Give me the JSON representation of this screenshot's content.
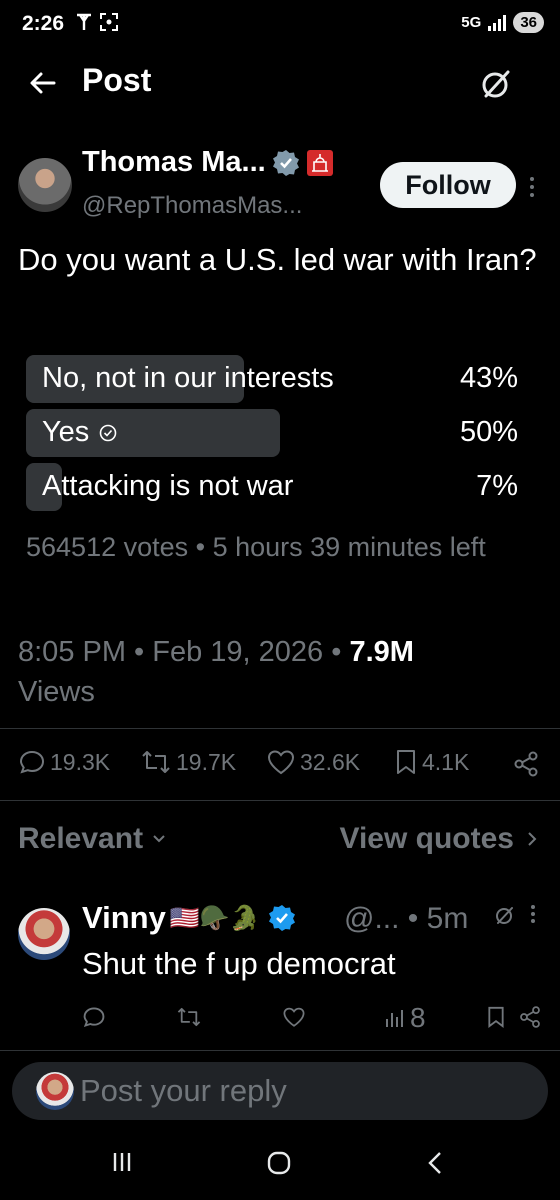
{
  "status_bar": {
    "time": "2:26",
    "network": "5G",
    "battery": "36"
  },
  "header": {
    "title": "Post"
  },
  "author": {
    "name": "Thomas Ma...",
    "handle": "@RepThomasMas...",
    "follow_label": "Follow"
  },
  "tweet": {
    "text": "Do you want a U.S. led war with Iran?"
  },
  "poll": {
    "options": [
      {
        "label": "No, not in our interests",
        "percent": "43%",
        "share": 0.43,
        "selected": false
      },
      {
        "label": "Yes",
        "percent": "50%",
        "share": 0.5,
        "selected": true
      },
      {
        "label": "Attacking is not war",
        "percent": "7%",
        "share": 0.07,
        "selected": false
      }
    ],
    "votes_line": "564512 votes • 5 hours 39 minutes left"
  },
  "meta": {
    "time_date": "8:05 PM • Feb 19, 2026 • ",
    "views_count": "7.9M",
    "views_label": "Views"
  },
  "actions": {
    "replies": "19.3K",
    "reposts": "19.7K",
    "likes": "32.6K",
    "bookmarks": "4.1K"
  },
  "replies_header": {
    "sort_label": "Relevant",
    "quotes_label": "View quotes"
  },
  "reply": {
    "name": "Vinny",
    "name_emojis": "🇺🇸🪖🐊",
    "handle_time": "@... • 5m",
    "text": "Shut the f up democrat",
    "views": "8"
  },
  "composer": {
    "placeholder": "Post your reply"
  },
  "colors": {
    "background": "#000000",
    "accent": "#1d9bf0",
    "muted": "#71767b",
    "poll_bar": "#333639"
  }
}
